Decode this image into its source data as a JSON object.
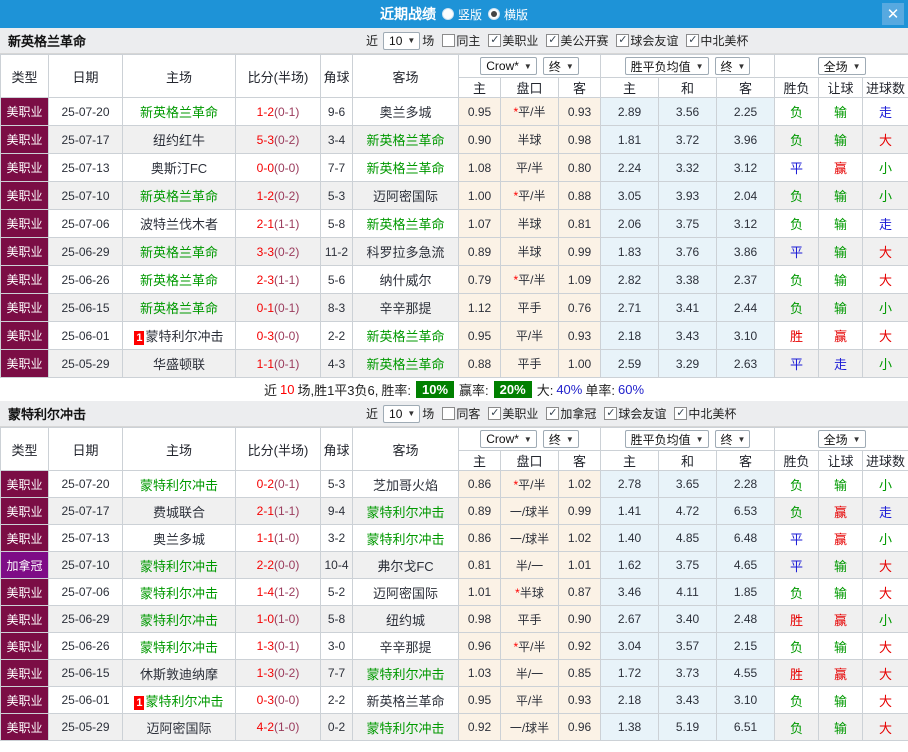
{
  "palette": {
    "g": "#009900",
    "r": "#e60000",
    "b": "#1a1ad6"
  },
  "palette_bg": {
    "m": "#7b0d45",
    "p": "#7e0c86"
  },
  "icons": {
    "check": "✓",
    "arrow": "▼",
    "close": "✕"
  },
  "titlebar": {
    "title": "近期战绩",
    "options": [
      {
        "label": "竖版",
        "checked": false
      },
      {
        "label": "横版",
        "checked": true
      }
    ]
  },
  "columns": {
    "type": "类型",
    "date": "日期",
    "home": "主场",
    "score": "比分(半场)",
    "corner": "角球",
    "away": "客场",
    "h_home": "主",
    "handicap": "盘口",
    "h_away": "客",
    "m_home": "主",
    "m_draw": "和",
    "m_away": "客",
    "wdl": "胜负",
    "hc": "让球",
    "ou": "进球数"
  },
  "sections": [
    {
      "team": "新英格兰革命",
      "filters": {
        "near": "近",
        "count": "10",
        "games": "场",
        "opts": [
          {
            "label": "同主",
            "checked": false
          },
          {
            "label": "美职业",
            "checked": true
          },
          {
            "label": "美公开赛",
            "checked": true
          },
          {
            "label": "球会友谊",
            "checked": true
          },
          {
            "label": "中北美杯",
            "checked": true
          }
        ]
      },
      "dropdowns": {
        "provider": "Crow*",
        "final_a": "终",
        "mean": "胜平负均值",
        "final_b": "终",
        "scope": "全场"
      },
      "rows": [
        {
          "type": "美职业",
          "tbg": "m",
          "date": "25-07-20",
          "home": "新英格兰革命",
          "homec": "g",
          "score": "1-2",
          "half": "(0-1)",
          "corner": "9-6",
          "away": "奥兰多城",
          "o1": "0.95",
          "star": "*",
          "line": "平/半",
          "o2": "0.93",
          "m1": "2.89",
          "m2": "3.56",
          "m3": "2.25",
          "r1": "负",
          "r1c": "g",
          "r2": "输",
          "r2c": "g",
          "r3": "走",
          "r3c": "b"
        },
        {
          "type": "美职业",
          "tbg": "m",
          "date": "25-07-17",
          "home": "纽约红牛",
          "score": "5-3",
          "half": "(0-2)",
          "corner": "3-4",
          "away": "新英格兰革命",
          "awayc": "g",
          "o1": "0.90",
          "line": "半球",
          "o2": "0.98",
          "m1": "1.81",
          "m2": "3.72",
          "m3": "3.96",
          "r1": "负",
          "r1c": "g",
          "r2": "输",
          "r2c": "g",
          "r3": "大",
          "r3c": "r"
        },
        {
          "type": "美职业",
          "tbg": "m",
          "date": "25-07-13",
          "home": "奥斯汀FC",
          "score": "0-0",
          "half": "(0-0)",
          "corner": "7-7",
          "away": "新英格兰革命",
          "awayc": "g",
          "o1": "1.08",
          "line": "平/半",
          "o2": "0.80",
          "m1": "2.24",
          "m2": "3.32",
          "m3": "3.12",
          "r1": "平",
          "r1c": "b",
          "r2": "赢",
          "r2c": "r",
          "r3": "小",
          "r3c": "g"
        },
        {
          "type": "美职业",
          "tbg": "m",
          "date": "25-07-10",
          "home": "新英格兰革命",
          "homec": "g",
          "score": "1-2",
          "half": "(0-2)",
          "corner": "5-3",
          "away": "迈阿密国际",
          "o1": "1.00",
          "star": "*",
          "line": "平/半",
          "o2": "0.88",
          "m1": "3.05",
          "m2": "3.93",
          "m3": "2.04",
          "r1": "负",
          "r1c": "g",
          "r2": "输",
          "r2c": "g",
          "r3": "小",
          "r3c": "g"
        },
        {
          "type": "美职业",
          "tbg": "m",
          "date": "25-07-06",
          "home": "波特兰伐木者",
          "score": "2-1",
          "half": "(1-1)",
          "corner": "5-8",
          "away": "新英格兰革命",
          "awayc": "g",
          "o1": "1.07",
          "line": "半球",
          "o2": "0.81",
          "m1": "2.06",
          "m2": "3.75",
          "m3": "3.12",
          "r1": "负",
          "r1c": "g",
          "r2": "输",
          "r2c": "g",
          "r3": "走",
          "r3c": "b"
        },
        {
          "type": "美职业",
          "tbg": "m",
          "date": "25-06-29",
          "home": "新英格兰革命",
          "homec": "g",
          "score": "3-3",
          "half": "(0-2)",
          "corner": "11-2",
          "away": "科罗拉多急流",
          "o1": "0.89",
          "line": "半球",
          "o2": "0.99",
          "m1": "1.83",
          "m2": "3.76",
          "m3": "3.86",
          "r1": "平",
          "r1c": "b",
          "r2": "输",
          "r2c": "g",
          "r3": "大",
          "r3c": "r"
        },
        {
          "type": "美职业",
          "tbg": "m",
          "date": "25-06-26",
          "home": "新英格兰革命",
          "homec": "g",
          "score": "2-3",
          "half": "(1-1)",
          "corner": "5-6",
          "away": "纳什威尔",
          "o1": "0.79",
          "star": "*",
          "line": "平/半",
          "o2": "1.09",
          "m1": "2.82",
          "m2": "3.38",
          "m3": "2.37",
          "r1": "负",
          "r1c": "g",
          "r2": "输",
          "r2c": "g",
          "r3": "大",
          "r3c": "r"
        },
        {
          "type": "美职业",
          "tbg": "m",
          "date": "25-06-15",
          "home": "新英格兰革命",
          "homec": "g",
          "score": "0-1",
          "half": "(0-1)",
          "corner": "8-3",
          "away": "辛辛那提",
          "o1": "1.12",
          "line": "平手",
          "o2": "0.76",
          "m1": "2.71",
          "m2": "3.41",
          "m3": "2.44",
          "r1": "负",
          "r1c": "g",
          "r2": "输",
          "r2c": "g",
          "r3": "小",
          "r3c": "g"
        },
        {
          "type": "美职业",
          "tbg": "m",
          "date": "25-06-01",
          "home": "蒙特利尔冲击",
          "red": "1",
          "score": "0-3",
          "half": "(0-0)",
          "corner": "2-2",
          "away": "新英格兰革命",
          "awayc": "g",
          "o1": "0.95",
          "line": "平/半",
          "o2": "0.93",
          "m1": "2.18",
          "m2": "3.43",
          "m3": "3.10",
          "r1": "胜",
          "r1c": "r",
          "r2": "赢",
          "r2c": "r",
          "r3": "大",
          "r3c": "r"
        },
        {
          "type": "美职业",
          "tbg": "m",
          "date": "25-05-29",
          "home": "华盛顿联",
          "score": "1-1",
          "half": "(0-1)",
          "corner": "4-3",
          "away": "新英格兰革命",
          "awayc": "g",
          "o1": "0.88",
          "line": "平手",
          "o2": "1.00",
          "m1": "2.59",
          "m2": "3.29",
          "m3": "2.63",
          "r1": "平",
          "r1c": "b",
          "r2": "走",
          "r2c": "b",
          "r3": "小",
          "r3c": "g"
        }
      ],
      "summary": {
        "near": "近",
        "n": "10",
        "record": "场,胜1平3负6,",
        "win_label": "胜率:",
        "win_pct": "10%",
        "earn_label": "赢率:",
        "earn_pct": "20%",
        "big_label": "大:",
        "big_pct": "40%",
        "single_label": "单率:",
        "single_pct": "60%"
      }
    },
    {
      "team": "蒙特利尔冲击",
      "filters": {
        "near": "近",
        "count": "10",
        "games": "场",
        "opts": [
          {
            "label": "同客",
            "checked": false
          },
          {
            "label": "美职业",
            "checked": true
          },
          {
            "label": "加拿冠",
            "checked": true
          },
          {
            "label": "球会友谊",
            "checked": true
          },
          {
            "label": "中北美杯",
            "checked": true
          }
        ]
      },
      "dropdowns": {
        "provider": "Crow*",
        "final_a": "终",
        "mean": "胜平负均值",
        "final_b": "终",
        "scope": "全场"
      },
      "rows": [
        {
          "type": "美职业",
          "tbg": "m",
          "date": "25-07-20",
          "home": "蒙特利尔冲击",
          "homec": "g",
          "score": "0-2",
          "half": "(0-1)",
          "corner": "5-3",
          "away": "芝加哥火焰",
          "o1": "0.86",
          "star": "*",
          "line": "平/半",
          "o2": "1.02",
          "m1": "2.78",
          "m2": "3.65",
          "m3": "2.28",
          "r1": "负",
          "r1c": "g",
          "r2": "输",
          "r2c": "g",
          "r3": "小",
          "r3c": "g"
        },
        {
          "type": "美职业",
          "tbg": "m",
          "date": "25-07-17",
          "home": "费城联合",
          "score": "2-1",
          "half": "(1-1)",
          "corner": "9-4",
          "away": "蒙特利尔冲击",
          "awayc": "g",
          "o1": "0.89",
          "line": "一/球半",
          "o2": "0.99",
          "m1": "1.41",
          "m2": "4.72",
          "m3": "6.53",
          "r1": "负",
          "r1c": "g",
          "r2": "赢",
          "r2c": "r",
          "r3": "走",
          "r3c": "b"
        },
        {
          "type": "美职业",
          "tbg": "m",
          "date": "25-07-13",
          "home": "奥兰多城",
          "score": "1-1",
          "half": "(1-0)",
          "corner": "3-2",
          "away": "蒙特利尔冲击",
          "awayc": "g",
          "o1": "0.86",
          "line": "一/球半",
          "o2": "1.02",
          "m1": "1.40",
          "m2": "4.85",
          "m3": "6.48",
          "r1": "平",
          "r1c": "b",
          "r2": "赢",
          "r2c": "r",
          "r3": "小",
          "r3c": "g"
        },
        {
          "type": "加拿冠",
          "tbg": "p",
          "date": "25-07-10",
          "home": "蒙特利尔冲击",
          "homec": "g",
          "score": "2-2",
          "half": "(0-0)",
          "corner": "10-4",
          "away": "弗尔戈FC",
          "o1": "0.81",
          "line": "半/一",
          "o2": "1.01",
          "m1": "1.62",
          "m2": "3.75",
          "m3": "4.65",
          "r1": "平",
          "r1c": "b",
          "r2": "输",
          "r2c": "g",
          "r3": "大",
          "r3c": "r"
        },
        {
          "type": "美职业",
          "tbg": "m",
          "date": "25-07-06",
          "home": "蒙特利尔冲击",
          "homec": "g",
          "score": "1-4",
          "half": "(1-2)",
          "corner": "5-2",
          "away": "迈阿密国际",
          "o1": "1.01",
          "star": "*",
          "line": "半球",
          "o2": "0.87",
          "m1": "3.46",
          "m2": "4.11",
          "m3": "1.85",
          "r1": "负",
          "r1c": "g",
          "r2": "输",
          "r2c": "g",
          "r3": "大",
          "r3c": "r"
        },
        {
          "type": "美职业",
          "tbg": "m",
          "date": "25-06-29",
          "home": "蒙特利尔冲击",
          "homec": "g",
          "score": "1-0",
          "half": "(1-0)",
          "corner": "5-8",
          "away": "纽约城",
          "o1": "0.98",
          "line": "平手",
          "o2": "0.90",
          "m1": "2.67",
          "m2": "3.40",
          "m3": "2.48",
          "r1": "胜",
          "r1c": "r",
          "r2": "赢",
          "r2c": "r",
          "r3": "小",
          "r3c": "g"
        },
        {
          "type": "美职业",
          "tbg": "m",
          "date": "25-06-26",
          "home": "蒙特利尔冲击",
          "homec": "g",
          "score": "1-3",
          "half": "(0-1)",
          "corner": "3-0",
          "away": "辛辛那提",
          "o1": "0.96",
          "star": "*",
          "line": "平/半",
          "o2": "0.92",
          "m1": "3.04",
          "m2": "3.57",
          "m3": "2.15",
          "r1": "负",
          "r1c": "g",
          "r2": "输",
          "r2c": "g",
          "r3": "大",
          "r3c": "r"
        },
        {
          "type": "美职业",
          "tbg": "m",
          "date": "25-06-15",
          "home": "休斯敦迪纳摩",
          "score": "1-3",
          "half": "(0-2)",
          "corner": "7-7",
          "away": "蒙特利尔冲击",
          "awayc": "g",
          "o1": "1.03",
          "line": "半/一",
          "o2": "0.85",
          "m1": "1.72",
          "m2": "3.73",
          "m3": "4.55",
          "r1": "胜",
          "r1c": "r",
          "r2": "赢",
          "r2c": "r",
          "r3": "大",
          "r3c": "r"
        },
        {
          "type": "美职业",
          "tbg": "m",
          "date": "25-06-01",
          "home": "蒙特利尔冲击",
          "homec": "g",
          "red": "1",
          "score": "0-3",
          "half": "(0-0)",
          "corner": "2-2",
          "away": "新英格兰革命",
          "o1": "0.95",
          "line": "平/半",
          "o2": "0.93",
          "m1": "2.18",
          "m2": "3.43",
          "m3": "3.10",
          "r1": "负",
          "r1c": "g",
          "r2": "输",
          "r2c": "g",
          "r3": "大",
          "r3c": "r"
        },
        {
          "type": "美职业",
          "tbg": "m",
          "date": "25-05-29",
          "home": "迈阿密国际",
          "score": "4-2",
          "half": "(1-0)",
          "corner": "0-2",
          "away": "蒙特利尔冲击",
          "awayc": "g",
          "o1": "0.92",
          "line": "一/球半",
          "o2": "0.96",
          "m1": "1.38",
          "m2": "5.19",
          "m3": "6.51",
          "r1": "负",
          "r1c": "g",
          "r2": "输",
          "r2c": "g",
          "r3": "大",
          "r3c": "r"
        }
      ]
    }
  ]
}
